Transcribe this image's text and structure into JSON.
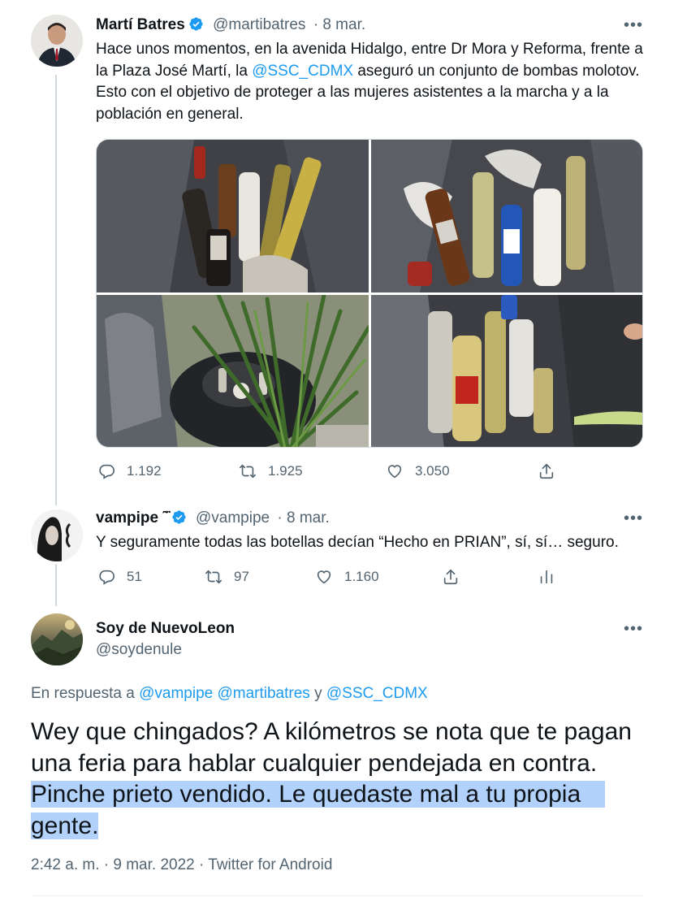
{
  "tweets": [
    {
      "name": "Martí Batres",
      "handle": "@martibatres",
      "date": "· 8 mar.",
      "text_before": "Hace unos momentos, en la avenida Hidalgo, entre Dr Mora y Reforma, frente a la Plaza José Martí, la ",
      "mention": "@SSC_CDMX",
      "text_after": " aseguró un conjunto de bombas molotov. Esto con el objetivo de proteger a las mujeres asistentes a la marcha y a la población en general.",
      "replies": "1.192",
      "retweets": "1.925",
      "likes": "3.050"
    },
    {
      "name": "vampipe ˜̈",
      "handle": "@vampipe",
      "date": "· 8 mar.",
      "text": "Y seguramente todas las botellas decían “Hecho en PRIAN”, sí, sí… seguro.",
      "replies": "51",
      "retweets": "97",
      "likes": "1.160"
    }
  ],
  "main_tweet": {
    "name": "Soy de NuevoLeon",
    "handle": "@soydenule",
    "reply_prefix": "En respuesta a ",
    "reply_mentions": "@vampipe @martibatres",
    "reply_and": " y ",
    "reply_last": "@SSC_CDMX",
    "text_line1": "Wey que chingados? A kilómetros se nota que te pagan",
    "text_line2": "una feria para hablar cualquier pendejada en contra.",
    "text_line3": "Pinche prieto vendido. Le quedaste mal a tu propia",
    "text_line4": "gente.",
    "meta": "2:42 a. m. · 9 mar. 2022 · Twitter for Android"
  },
  "more_label": "•••",
  "colors": {
    "accent": "#1d9bf0",
    "muted": "#536471",
    "highlight": "#b3d2fb"
  }
}
